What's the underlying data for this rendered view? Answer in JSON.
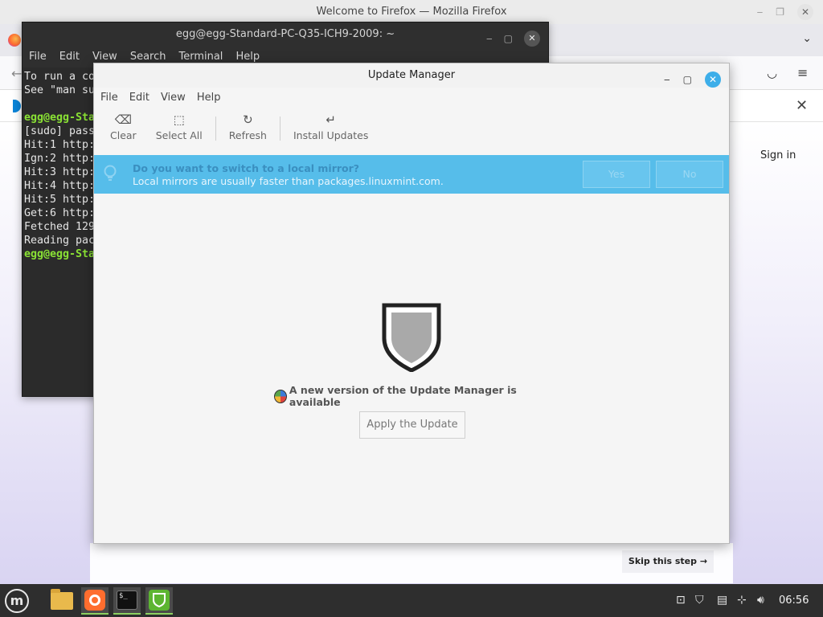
{
  "firefox": {
    "window_title": "Welcome to Firefox — Mozilla Firefox",
    "sign_in": "Sign in",
    "skip_step": "Skip this step →"
  },
  "terminal": {
    "window_title": "egg@egg-Standard-PC-Q35-ICH9-2009: ~",
    "menu": [
      "File",
      "Edit",
      "View",
      "Search",
      "Terminal",
      "Help"
    ],
    "lines": [
      {
        "text": "To run a co",
        "prompt": false
      },
      {
        "text": "See \"man su",
        "prompt": false
      },
      {
        "text": "",
        "prompt": false
      },
      {
        "text": "egg@egg-Sta",
        "prompt": true
      },
      {
        "text": "[sudo] pass",
        "prompt": false
      },
      {
        "text": "Hit:1 http:",
        "prompt": false
      },
      {
        "text": "Ign:2 http:",
        "prompt": false
      },
      {
        "text": "Hit:3 http:",
        "prompt": false
      },
      {
        "text": "Hit:4 http:",
        "prompt": false
      },
      {
        "text": "Hit:5 http:",
        "prompt": false
      },
      {
        "text": "Get:6 http:",
        "prompt": false
      },
      {
        "text": "Fetched 129",
        "prompt": false
      },
      {
        "text": "Reading pac",
        "prompt": false
      },
      {
        "text": "egg@egg-Sta",
        "prompt": true
      }
    ]
  },
  "update_manager": {
    "window_title": "Update Manager",
    "menu": {
      "file": "File",
      "edit": "Edit",
      "view": "View",
      "help": "Help"
    },
    "toolbar": {
      "clear": "Clear",
      "select_all": "Select All",
      "refresh": "Refresh",
      "install": "Install Updates"
    },
    "infobar": {
      "title": "Do you want to switch to a local mirror?",
      "subtitle": "Local mirrors are usually faster than packages.linuxmint.com.",
      "yes": "Yes",
      "no": "No"
    },
    "new_version_text": "A new version of the Update Manager is available",
    "apply_button": "Apply the Update"
  },
  "taskbar": {
    "clock": "06:56",
    "apps": [
      "folder-icon",
      "firefox-icon",
      "terminal-icon",
      "update-manager-icon"
    ]
  },
  "colors": {
    "infobar_bg": "#56bdea",
    "prompt_green": "#8ae234",
    "close_button_blue": "#3daee9"
  }
}
